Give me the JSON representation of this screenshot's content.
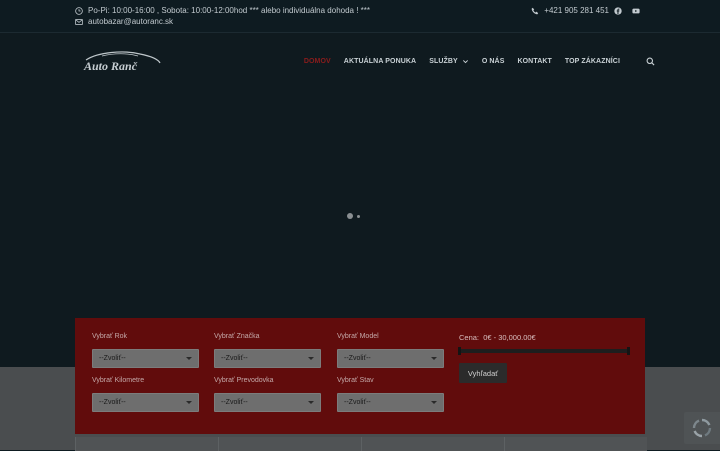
{
  "topbar": {
    "hours": "Po-Pi: 10:00-16:00 , Sobota: 10:00-12:00hod *** alebo individuálna dohoda ! ***",
    "email": "autobazar@autoranc.sk",
    "phone": "+421 905 281 451",
    "icons": [
      "clock-icon",
      "envelope-icon",
      "phone-icon",
      "facebook-icon",
      "youtube-icon"
    ]
  },
  "logo": {
    "text": "Auto Ranč"
  },
  "nav": {
    "items": [
      {
        "label": "DOMOV",
        "active": true
      },
      {
        "label": "AKTUÁLNA PONUKA"
      },
      {
        "label": "SLUŽBY",
        "has_dropdown": true
      },
      {
        "label": "O NÁS"
      },
      {
        "label": "KONTAKT"
      },
      {
        "label": "TOP ZÁKAZNÍCI"
      }
    ]
  },
  "search_form": {
    "fields": [
      {
        "label": "Vybrať Rok",
        "value": "--Zvoliť--"
      },
      {
        "label": "Vybrať Značka",
        "value": "--Zvoliť--"
      },
      {
        "label": "Vybrať Model",
        "value": "--Zvoliť--"
      },
      {
        "label": "Vybrať Kilometre",
        "value": "--Zvoliť--"
      },
      {
        "label": "Vybrať Prevodovka",
        "value": "--Zvoliť--"
      },
      {
        "label": "Vybrať Stav",
        "value": "--Zvoliť--"
      }
    ],
    "price_label": "Cena:",
    "price_range": "0€ - 30,000.00€",
    "submit_label": "Vyhľadať"
  },
  "colors": {
    "accent_red": "#610c0c",
    "active_nav": "#8a1c1c",
    "background": "#0e1b21"
  }
}
